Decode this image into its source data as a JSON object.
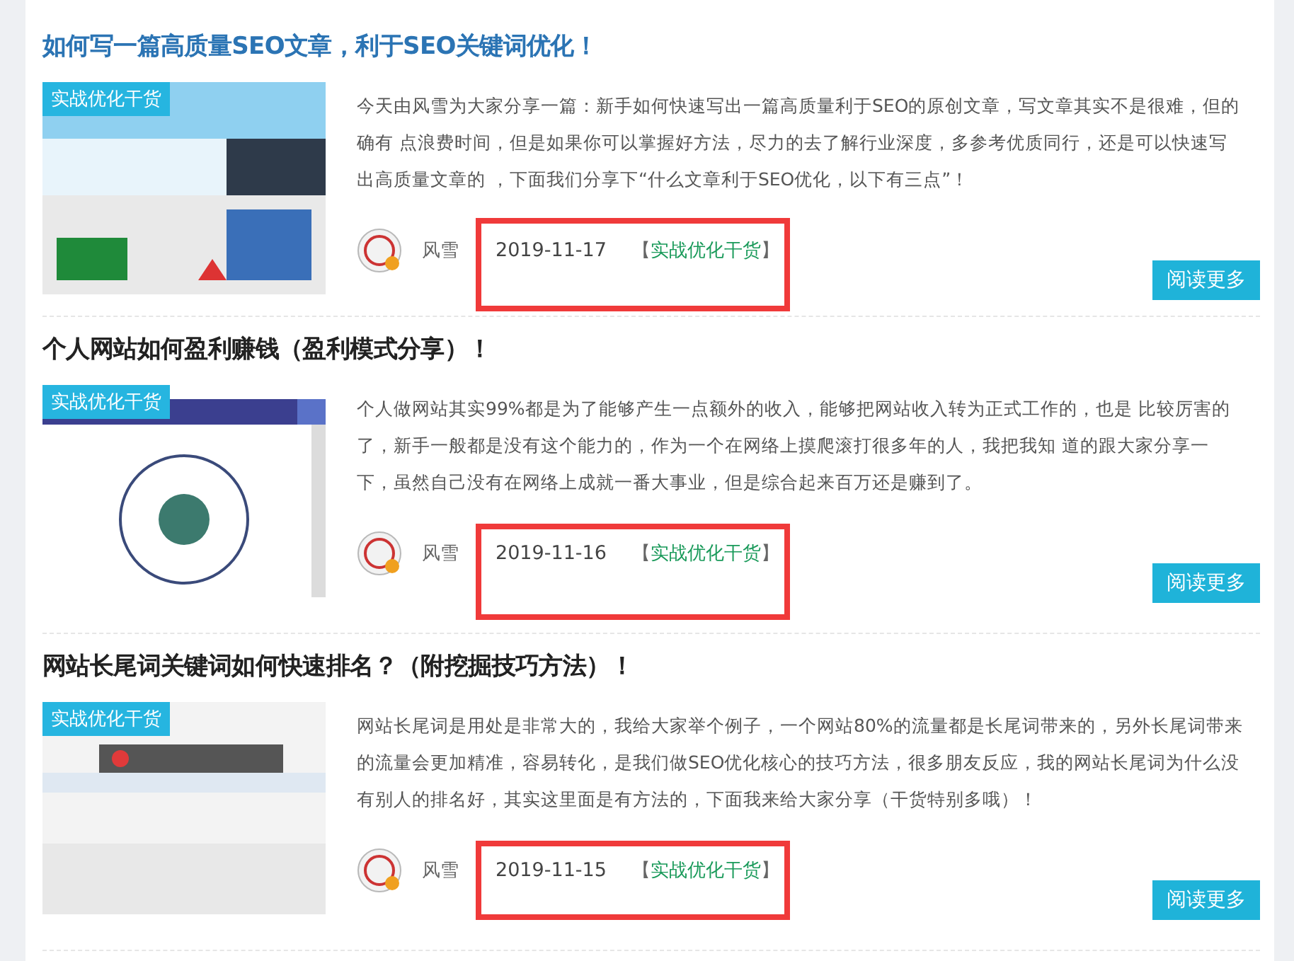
{
  "posts": [
    {
      "title": "如何写一篇高质量SEO文章，利于SEO关键词优化！",
      "hovered": true,
      "badge": "实战优化干货",
      "excerpt": "今天由风雪为大家分享一篇：新手如何快速写出一篇高质量利于SEO的原创文章，写文章其实不是很难，但的确有 点浪费时间，但是如果你可以掌握好方法，尽力的去了解行业深度，多参考优质同行，还是可以快速写出高质量文章的 ，下面我们分享下“什么文章利于SEO优化，以下有三点”！",
      "author": "风雪",
      "date": "2019-11-17",
      "category": "实战优化干货",
      "bracket_open": "【",
      "bracket_close": "】",
      "button": "阅读更多",
      "highlighted": true
    },
    {
      "title": "个人网站如何盈利赚钱（盈利模式分享）！",
      "hovered": false,
      "badge": "实战优化干货",
      "excerpt": "个人做网站其实99%都是为了能够产生一点额外的收入，能够把网站收入转为正式工作的，也是 比较厉害的了，新手一般都是没有这个能力的，作为一个在网络上摸爬滚打很多年的人，我把我知 道的跟大家分享一下，虽然自己没有在网络上成就一番大事业，但是综合起来百万还是赚到了。",
      "author": "风雪",
      "date": "2019-11-16",
      "category": "实战优化干货",
      "bracket_open": "【",
      "bracket_close": "】",
      "button": "阅读更多",
      "highlighted": true
    },
    {
      "title": "网站长尾词关键词如何快速排名？（附挖掘技巧方法）！",
      "hovered": false,
      "badge": "实战优化干货",
      "excerpt": "网站长尾词是用处是非常大的，我给大家举个例子，一个网站80%的流量都是长尾词带来的，另外长尾词带来的流量会更加精准，容易转化，是我们做SEO优化核心的技巧方法，很多朋友反应，我的网站长尾词为什么没有别人的排名好，其实这里面是有方法的，下面我来给大家分享（干货特别多哦）！",
      "author": "风雪",
      "date": "2019-11-15",
      "category": "实战优化干货",
      "bracket_open": "【",
      "bracket_close": "】",
      "button": "阅读更多",
      "highlighted": true
    }
  ]
}
